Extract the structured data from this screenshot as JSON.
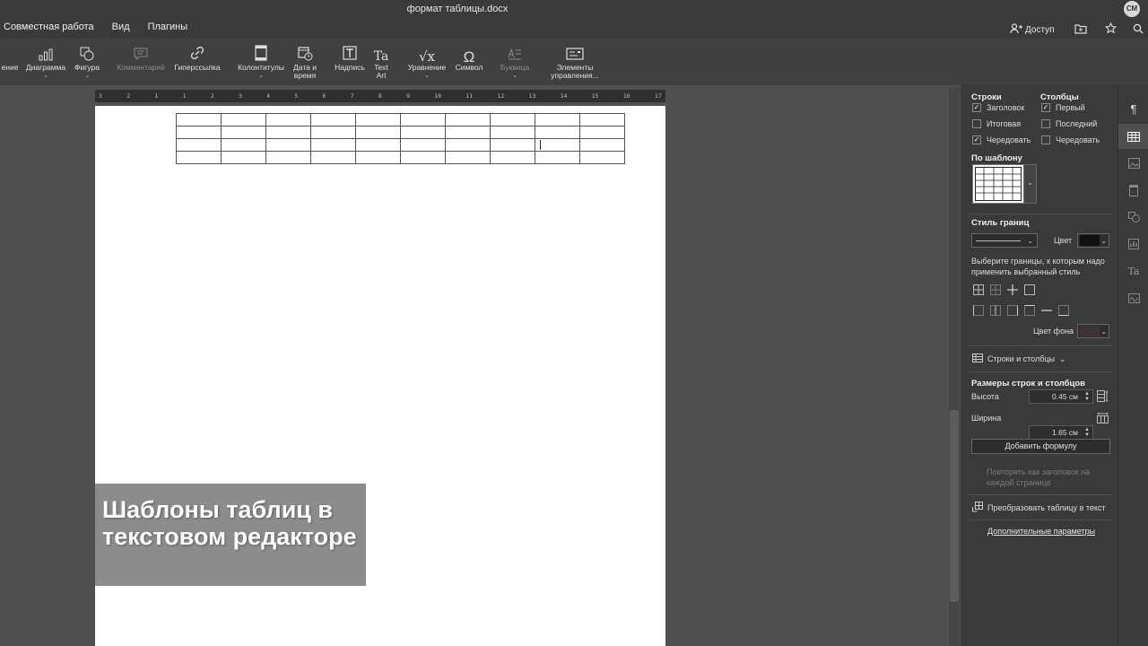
{
  "window": {
    "title": "формат таблицы.docx",
    "user_initials": "СМ"
  },
  "menu": [
    "Совместная работа",
    "Вид",
    "Плагины"
  ],
  "top_actions": {
    "access": "Доступ"
  },
  "toolbar": {
    "items": [
      {
        "label": "ение",
        "caret": false,
        "disabled": false
      },
      {
        "label": "Диаграмма",
        "caret": true,
        "disabled": false
      },
      {
        "label": "Фигура",
        "caret": true,
        "disabled": false
      },
      {
        "label": "Комментарий",
        "caret": false,
        "disabled": true
      },
      {
        "label": "Гиперссылка",
        "caret": false,
        "disabled": false
      },
      {
        "label": "Колонтитулы",
        "caret": true,
        "disabled": false
      },
      {
        "label": "Дата и время",
        "caret": false,
        "disabled": false
      },
      {
        "label": "Надпись",
        "caret": false,
        "disabled": false
      },
      {
        "label": "Text Art",
        "caret": true,
        "disabled": false
      },
      {
        "label": "Уравнение",
        "caret": true,
        "disabled": false
      },
      {
        "label": "Символ",
        "caret": false,
        "disabled": false
      },
      {
        "label": "Буквица",
        "caret": true,
        "disabled": true
      },
      {
        "label": "Элементы управления...",
        "caret": true,
        "disabled": false
      }
    ]
  },
  "ruler": {
    "marks": [
      "3",
      "2",
      "1",
      "1",
      "2",
      "3",
      "4",
      "5",
      "6",
      "7",
      "8",
      "9",
      "10",
      "11",
      "12",
      "13",
      "14",
      "15",
      "16",
      "17"
    ]
  },
  "document": {
    "table": {
      "rows": 4,
      "cols": 10
    },
    "overlay_caption": "Шаблоны таблиц в текстовом редакторе"
  },
  "panel": {
    "rows_header": "Строки",
    "cols_header": "Столбцы",
    "rows_options": [
      {
        "label": "Заголовок",
        "checked": true
      },
      {
        "label": "Итоговая",
        "checked": false
      },
      {
        "label": "Чередовать",
        "checked": true
      }
    ],
    "cols_options": [
      {
        "label": "Первый",
        "checked": true
      },
      {
        "label": "Последний",
        "checked": false
      },
      {
        "label": "Чередовать",
        "checked": false
      }
    ],
    "template_header": "По шаблону",
    "border_style_header": "Стиль границ",
    "color_label": "Цвет",
    "border_color": "#111111",
    "borders_hint": "Выберите границы, к которым надо применить выбранный стиль",
    "bg_color_label": "Цвет фона",
    "rows_cols_label": "Строки и столбцы",
    "sizes_header": "Размеры строк и столбцов",
    "height_label": "Высота",
    "height_value": "0.45 см",
    "width_label": "Ширина",
    "width_value": "1.65 см",
    "add_formula": "Добавить формулу",
    "repeat_header": "Повторять как заголовок на каждой странице",
    "convert_to_text": "Преобразовать таблицу в текст",
    "advanced": "Дополнительные параметры"
  },
  "colors": {
    "titlebar": "#3a3a3a",
    "toolbar": "#404040",
    "workspace": "#505050",
    "panel": "#3a3a3a"
  }
}
